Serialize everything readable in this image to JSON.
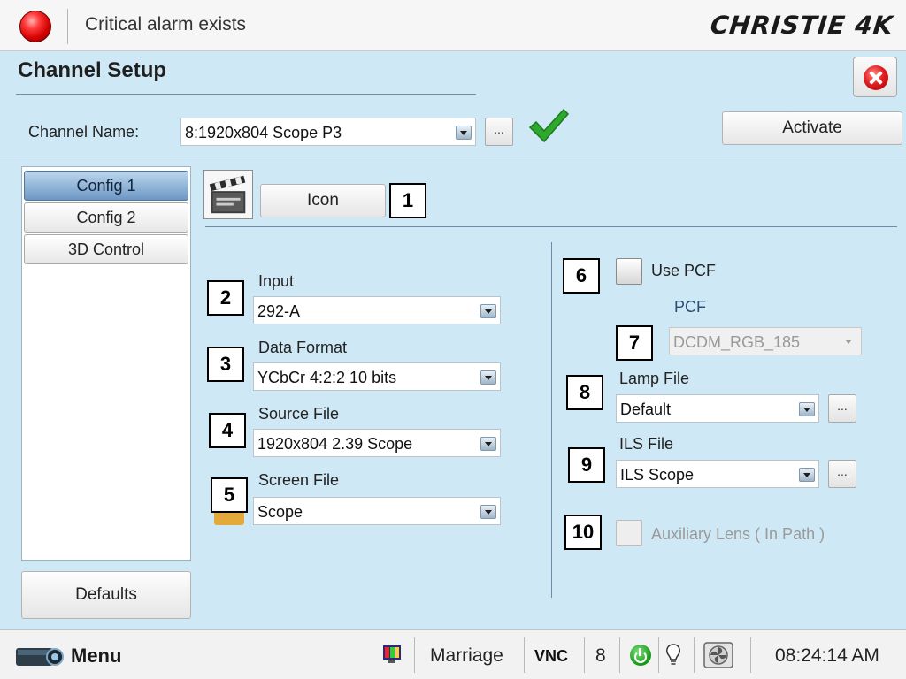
{
  "topbar": {
    "alarm_text": "Critical alarm exists",
    "brand": "CHRISTIE 4K"
  },
  "header": {
    "title": "Channel Setup",
    "channel_label": "Channel Name:",
    "channel_value": "8:1920x804 Scope P3",
    "more_label": "...",
    "activate_label": "Activate"
  },
  "sidebar": {
    "tabs": [
      {
        "label": "Config 1",
        "active": true
      },
      {
        "label": "Config 2",
        "active": false
      },
      {
        "label": "3D Control",
        "active": false
      }
    ],
    "defaults_label": "Defaults"
  },
  "config": {
    "icon_button_label": "Icon",
    "input": {
      "label": "Input",
      "value": "292-A"
    },
    "data_format": {
      "label": "Data Format",
      "value": "YCbCr 4:2:2 10 bits"
    },
    "source_file": {
      "label": "Source File",
      "value": "1920x804 2.39 Scope"
    },
    "screen_file": {
      "label": "Screen File",
      "value": "Scope"
    },
    "use_pcf": {
      "label": "Use PCF",
      "checked": false
    },
    "pcf": {
      "label": "PCF",
      "value": "DCDM_RGB_185",
      "enabled": false
    },
    "lamp_file": {
      "label": "Lamp File",
      "value": "Default"
    },
    "ils_file": {
      "label": "ILS File",
      "value": "ILS Scope"
    },
    "aux_lens": {
      "label": "Auxiliary Lens ( In Path )",
      "checked": false,
      "enabled": false
    },
    "more_label": "..."
  },
  "callouts": [
    "1",
    "2",
    "3",
    "4",
    "5",
    "6",
    "7",
    "8",
    "9",
    "10"
  ],
  "statusbar": {
    "menu_label": "Menu",
    "marriage": "Marriage",
    "vnc": "VNC",
    "count": "8",
    "time": "08:24:14 AM"
  },
  "colors": {
    "background": "#cfe8f5",
    "active_tab": "#6c97c3",
    "alarm": "#d40000",
    "accept": "#2fa82f"
  }
}
